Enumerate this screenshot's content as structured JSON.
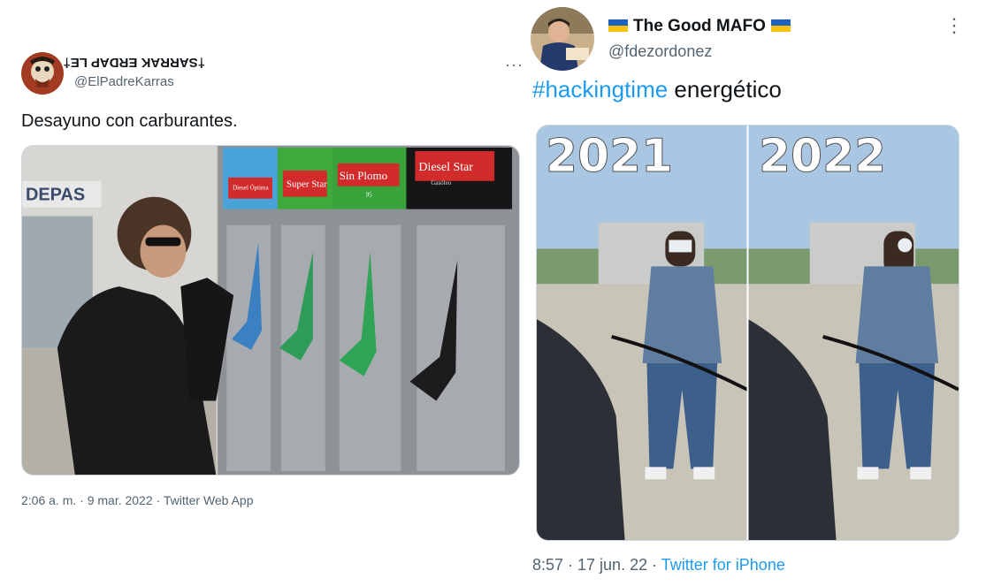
{
  "left_tweet": {
    "display_name": "†SARRAK ERDAP LE†",
    "handle": "@ElPadreKarras",
    "text": "Desayuno con carburantes.",
    "media": {
      "pump_labels": [
        "Diesel Óptima",
        "Super Star",
        "Sin Plomo",
        "Diesel Star"
      ],
      "pump_sublabels": [
        "",
        "",
        "95",
        "Gasóleo"
      ],
      "storefront_sign": "DEPAS"
    },
    "timestamp": "2:06 a. m. · 9 mar. 2022 · Twitter Web App",
    "more_label": "···"
  },
  "right_tweet": {
    "display_name": "The Good MAFO",
    "flag_left": "🇺🇦",
    "flag_right": "🇺🇦",
    "handle": "@fdezordonez",
    "hashtag": "#hackingtime",
    "text_rest": " energético",
    "media": {
      "panel_left_year": "2021",
      "panel_right_year": "2022"
    },
    "time": "8:57 · 17 jun. 22 · ",
    "source": "Twitter for iPhone",
    "more_label": "⋮"
  },
  "colors": {
    "text": "#0f1419",
    "secondary": "#536471",
    "accent": "#1d9bf0",
    "border": "#cfd9de"
  }
}
